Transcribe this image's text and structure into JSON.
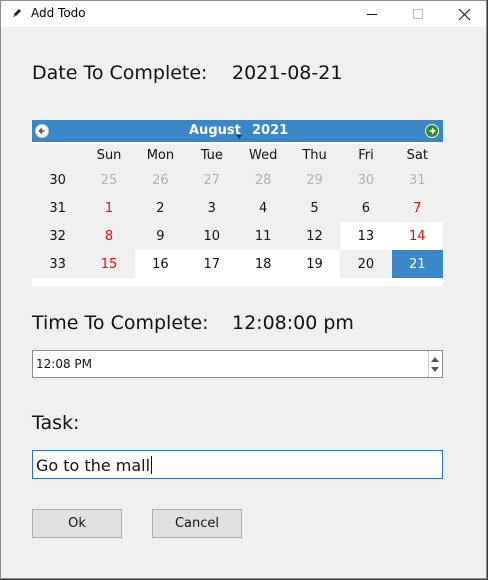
{
  "window": {
    "title": "Add Todo",
    "app_icon": "pencil-icon",
    "controls": [
      "minimize-icon",
      "maximize-icon",
      "close-icon"
    ]
  },
  "date": {
    "label": "Date To Complete:",
    "value": "2021-08-21"
  },
  "calendar": {
    "month": "August",
    "year": "2021",
    "prev_icon": "arrow-left-icon",
    "next_icon": "arrow-right-icon",
    "header_color": "#3a86c6",
    "selected_color": "#3a86c6",
    "weekend_color": "#e01010",
    "day_headers": [
      "Sun",
      "Mon",
      "Tue",
      "Wed",
      "Thu",
      "Fri",
      "Sat"
    ],
    "weeks": [
      {
        "week": "30",
        "days": [
          {
            "d": "25",
            "t": "other"
          },
          {
            "d": "26",
            "t": "other"
          },
          {
            "d": "27",
            "t": "other"
          },
          {
            "d": "28",
            "t": "other"
          },
          {
            "d": "29",
            "t": "other"
          },
          {
            "d": "30",
            "t": "other"
          },
          {
            "d": "31",
            "t": "other"
          }
        ]
      },
      {
        "week": "31",
        "days": [
          {
            "d": "1",
            "t": "weekend"
          },
          {
            "d": "2",
            "t": ""
          },
          {
            "d": "3",
            "t": ""
          },
          {
            "d": "4",
            "t": ""
          },
          {
            "d": "5",
            "t": ""
          },
          {
            "d": "6",
            "t": ""
          },
          {
            "d": "7",
            "t": "weekend"
          }
        ]
      },
      {
        "week": "32",
        "days": [
          {
            "d": "8",
            "t": "weekend"
          },
          {
            "d": "9",
            "t": ""
          },
          {
            "d": "10",
            "t": ""
          },
          {
            "d": "11",
            "t": ""
          },
          {
            "d": "12",
            "t": ""
          },
          {
            "d": "13",
            "t": "plain"
          },
          {
            "d": "14",
            "t": "weekend plain"
          }
        ]
      },
      {
        "week": "33",
        "days": [
          {
            "d": "15",
            "t": "weekend"
          },
          {
            "d": "16",
            "t": "plain"
          },
          {
            "d": "17",
            "t": "plain"
          },
          {
            "d": "18",
            "t": "plain"
          },
          {
            "d": "19",
            "t": "plain"
          },
          {
            "d": "20",
            "t": ""
          },
          {
            "d": "21",
            "t": "sel"
          }
        ]
      }
    ]
  },
  "time": {
    "label": "Time To Complete:",
    "value": "12:08:00 pm",
    "spin_value": "12:08 PM"
  },
  "task": {
    "label": "Task:",
    "value": "Go to the mall"
  },
  "buttons": {
    "ok": "Ok",
    "cancel": "Cancel"
  }
}
